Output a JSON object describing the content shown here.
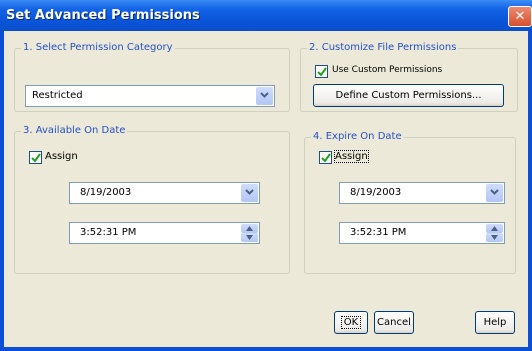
{
  "window": {
    "title": "Set Advanced Permissions",
    "close_glyph": "✕"
  },
  "category": {
    "label": "1. Select Permission Category",
    "selected": "Restricted"
  },
  "customize": {
    "label": "2. Customize File Permissions",
    "use_custom_label": "Use Custom Permissions",
    "use_custom_checked": true,
    "define_button": "Define Custom Permissions..."
  },
  "available": {
    "label": "3. Available On Date",
    "assign_label": "Assign",
    "assign_checked": true,
    "date": "8/19/2003",
    "time": "3:52:31 PM"
  },
  "expire": {
    "label": "4. Expire On Date",
    "assign_label": "Assign",
    "assign_checked": true,
    "date": "8/19/2003",
    "time": "3:52:31 PM"
  },
  "buttons": {
    "ok": "OK",
    "cancel": "Cancel",
    "help": "Help"
  },
  "icons": {
    "dropdown": "chevron-down-icon",
    "spin_up": "arrow-up-icon",
    "spin_down": "arrow-down-icon",
    "check": "check-icon",
    "close": "close-icon"
  },
  "colors": {
    "title_bar": "#0a54d8",
    "dialog_bg": "#ece9d8",
    "group_label": "#2450c8",
    "close_button": "#d8502d",
    "check_mark": "#21a121"
  }
}
